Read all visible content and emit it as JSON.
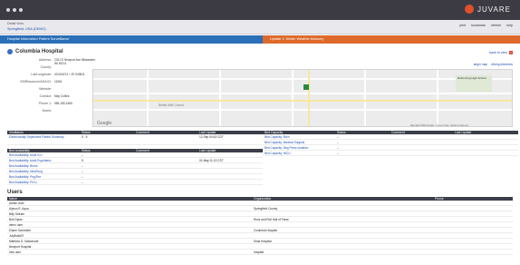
{
  "app": {
    "brand": "JUVARE"
  },
  "subhead": {
    "crumb_main": "Detail View",
    "crumb_location": "Springfield, USA (DEMO)",
    "tools": [
      "print",
      "bookmark",
      "refresh",
      "help"
    ]
  },
  "alerts": {
    "left": "Hospital Information Patient Surveillance",
    "right": "Update 1: Winter Weather Advisory"
  },
  "hospital": {
    "title": "Columbia Hospital",
    "back_link": "back to view",
    "info": [
      {
        "k": "Address:",
        "v": "2321 E Newport Ave Milwaukee, WI 53211"
      },
      {
        "k": "County:",
        "v": ""
      },
      {
        "k": "Lat/Longitude:",
        "v": "43.063474 / -87.949811"
      },
      {
        "k": "EMResource/AHA ID:",
        "v": "11961"
      },
      {
        "k": "Website:",
        "v": ""
      },
      {
        "k": "Contact:",
        "v": "May Collins"
      },
      {
        "k": "Phone 1:",
        "v": "555-155-1565"
      },
      {
        "k": "Notes:",
        "v": ""
      }
    ],
    "map_links": [
      "larger map",
      "driving directions"
    ],
    "map_labels": {
      "school": "Rufus King High School",
      "church": "Bethel AME Church",
      "google": "Google",
      "attrib": "Map data ©2019 Google · Terms of Use · Report a map error"
    }
  },
  "tables": {
    "left_top": {
      "headers": [
        "Ventilators",
        "Status",
        "Comment",
        "Last Update"
      ],
      "rows": [
        [
          "Electronically Dependent Patient Summary",
          "0 - 9",
          "",
          "12-Sep 04:43 CDT"
        ]
      ]
    },
    "left_bottom": {
      "headers": [
        "Bed Availability",
        "Status",
        "Comment",
        "Last Update"
      ],
      "rows": [
        [
          "Bed Availability: Adult ICU",
          "--",
          "",
          ""
        ],
        [
          "Bed Availability: Adult Psychiatric",
          "5",
          "",
          "01-May 11:13 CST"
        ],
        [
          "Bed Availability: Burns",
          "--",
          "",
          ""
        ],
        [
          "Bed Availability: Med/Surg",
          "--",
          "",
          ""
        ],
        [
          "Bed Availability: Peg/Fire",
          "--",
          "",
          ""
        ],
        [
          "Bed Availability: PICU",
          "--",
          "",
          ""
        ]
      ]
    },
    "right_top": {
      "headers": [
        "Bed Capacity",
        "Status",
        "Comment",
        "Last Update"
      ],
      "rows": [
        [
          "Bed Capacity: Burn",
          "--",
          "",
          ""
        ],
        [
          "Bed Capacity: Medical Surgical",
          "--",
          "",
          ""
        ],
        [
          "Bed Capacity: Neg Press Isolation",
          "--",
          "",
          ""
        ],
        [
          "Bed Capacity: NICU",
          "--",
          "",
          ""
        ]
      ]
    }
  },
  "users": {
    "label": "Users",
    "headers": [
      "Name",
      "Organization",
      "Phone"
    ],
    "rows": [
      [
        "Admin User",
        "",
        ""
      ],
      [
        "Alyson E. Aqua",
        "Springfield County",
        ""
      ],
      [
        "Billy Stream",
        "",
        ""
      ],
      [
        "Bob Dylan",
        "Rock and Roll Hall of Fame",
        ""
      ],
      [
        "demo user",
        "",
        ""
      ],
      [
        "Elaine Schneider",
        "Columbia Hospital",
        ""
      ],
      [
        "JulyBuild07",
        "",
        ""
      ],
      [
        "Matthew G. Mackenzie",
        "Sinai Hospital",
        ""
      ],
      [
        "Newport Hospital",
        "",
        ""
      ],
      [
        "new user",
        "hospital",
        ""
      ]
    ]
  }
}
